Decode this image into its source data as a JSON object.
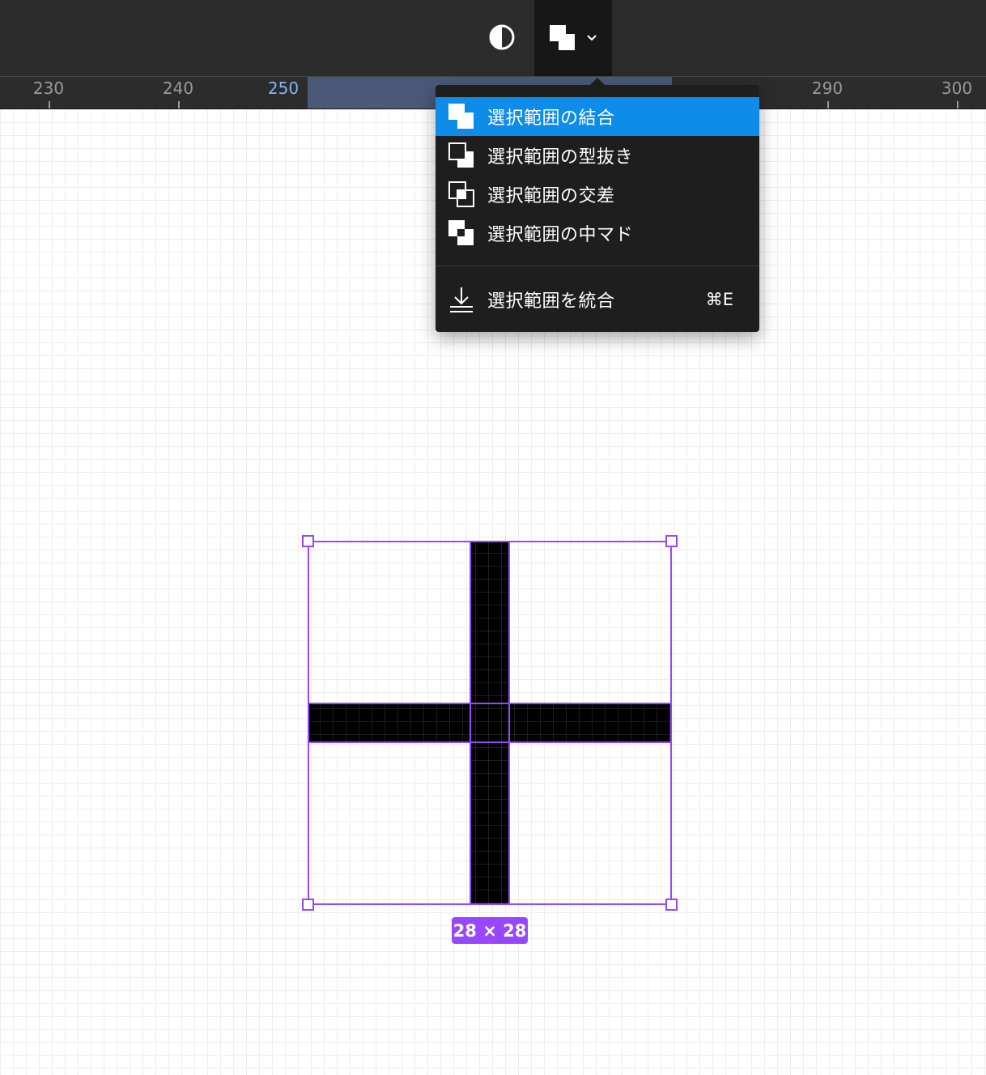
{
  "toolbar": {
    "contrast_icon": "half-circle-icon",
    "boolean_icon": "union-icon",
    "dropdown_icon": "chevron-down-icon"
  },
  "ruler": {
    "labels": [
      {
        "text": "230",
        "highlighted": false
      },
      {
        "text": "240",
        "highlighted": false
      },
      {
        "text": "250",
        "highlighted": true
      },
      {
        "text": "290",
        "highlighted": false
      },
      {
        "text": "300",
        "highlighted": false
      }
    ]
  },
  "menu": {
    "items": [
      {
        "label": "選択範囲の結合",
        "icon": "union-icon",
        "selected": true
      },
      {
        "label": "選択範囲の型抜き",
        "icon": "subtract-icon",
        "selected": false
      },
      {
        "label": "選択範囲の交差",
        "icon": "intersect-icon",
        "selected": false
      },
      {
        "label": "選択範囲の中マド",
        "icon": "exclude-icon",
        "selected": false
      }
    ],
    "flatten": {
      "label": "選択範囲を統合",
      "shortcut": "⌘E",
      "icon": "flatten-icon"
    }
  },
  "selection": {
    "size_label": "28 × 28"
  },
  "colors": {
    "accent": "#0d8ce9",
    "selection": "#9747ff",
    "toolbar_bg": "#2c2c2c",
    "menu_bg": "#1e1e1e"
  }
}
